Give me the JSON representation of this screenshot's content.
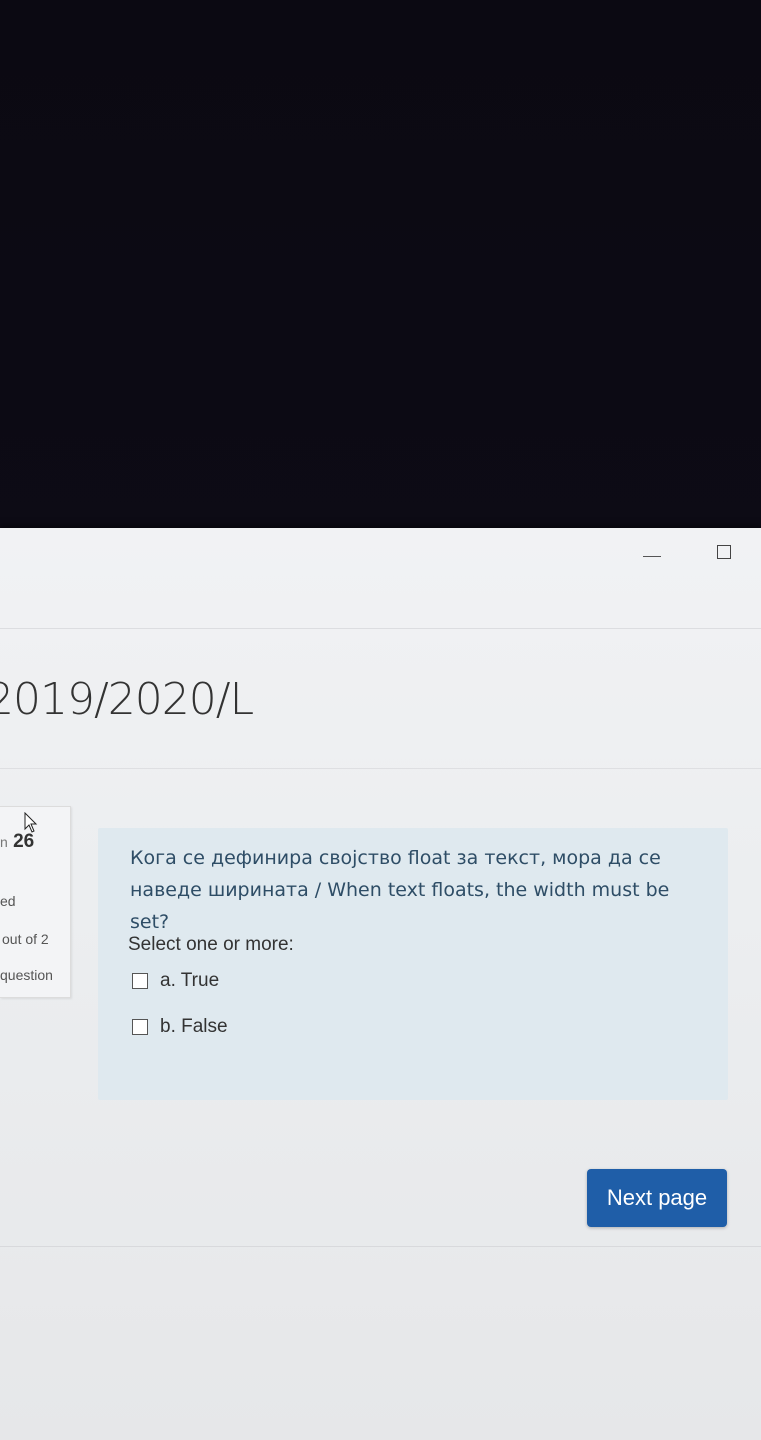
{
  "window_controls": {
    "minimize_label": "—",
    "maximize_label": ""
  },
  "course": {
    "title": "2019/2020/L"
  },
  "info": {
    "question_prefix": "n",
    "question_number": "26",
    "state": "ed",
    "mark": "out of 2",
    "flag": "question"
  },
  "question": {
    "text": "Кога се дефинира својство float за текст, мора да се наведе ширината / When text floats, the width must be set?",
    "prompt": "Select one or more:",
    "answers": [
      {
        "label": "a. True",
        "checked": false
      },
      {
        "label": "b. False",
        "checked": false
      }
    ]
  },
  "navigation": {
    "next_label": "Next page"
  },
  "colors": {
    "accent": "#1f5ea8",
    "question_bg": "#dfe9ef",
    "question_text": "#2e4d66"
  }
}
